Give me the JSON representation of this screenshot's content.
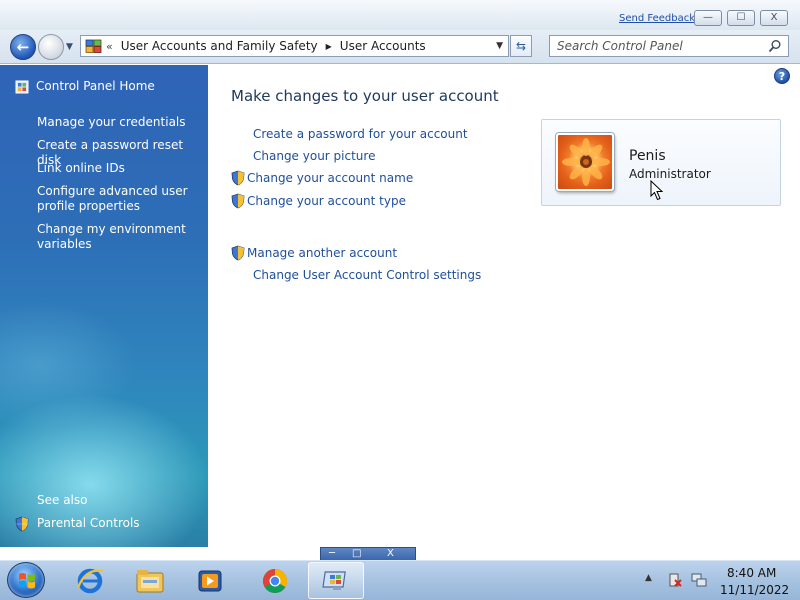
{
  "window": {
    "send_feedback": "Send Feedback",
    "minimize_glyph": "—",
    "maximize_glyph": "☐",
    "close_glyph": "X"
  },
  "address": {
    "overflow": "«",
    "crumbs": [
      "User Accounts and Family Safety",
      "User Accounts"
    ]
  },
  "search": {
    "placeholder": "Search Control Panel"
  },
  "nav_pane": {
    "home": "Control Panel Home",
    "links": [
      "Manage your credentials",
      "Create a password reset disk",
      "Link online IDs",
      "Configure advanced user profile properties",
      "Change my environment variables"
    ],
    "see_also_title": "See also",
    "see_also_links": [
      "Parental Controls"
    ]
  },
  "main": {
    "title": "Make changes to your user account",
    "tasks": [
      "Create a password for your account",
      "Change your picture",
      "Change your account name",
      "Change your account type"
    ],
    "other_tasks": [
      "Manage another account",
      "Change User Account Control settings"
    ],
    "help_glyph": "?"
  },
  "account": {
    "name": "Penis",
    "type": "Administrator"
  },
  "taskbar": {
    "apps": [
      "internet-explorer",
      "windows-explorer",
      "media-player",
      "chrome",
      "control-panel"
    ],
    "active_app": "control-panel"
  },
  "clock": {
    "time": "8:40 AM",
    "date": "11/11/2022"
  },
  "colors": {
    "link": "#1f4f9a",
    "title": "#1e395b",
    "nav_pane_top": "#2f63b6",
    "nav_pane_bottom": "#2a7fa6"
  }
}
